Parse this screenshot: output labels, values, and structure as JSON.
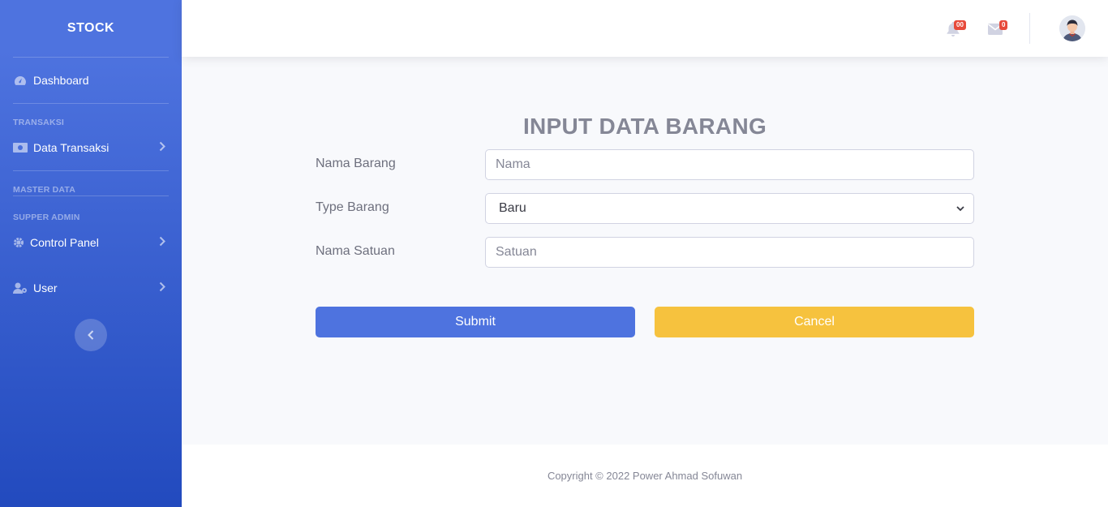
{
  "sidebar": {
    "brand": "STOCK",
    "dashboard": "Dashboard",
    "heading_transaksi": "TRANSAKSI",
    "data_transaksi": "Data Transaksi",
    "heading_master": "MASTER DATA",
    "heading_supper": "SUPPER ADMIN",
    "control_panel": "Control Panel",
    "user": "User"
  },
  "topbar": {
    "alerts_count": "00",
    "messages_count": "0"
  },
  "form": {
    "title": "INPUT DATA BARANG",
    "nama_barang_label": "Nama Barang",
    "nama_barang_placeholder": "Nama",
    "type_barang_label": "Type Barang",
    "type_barang_value": "Baru",
    "nama_satuan_label": "Nama Satuan",
    "nama_satuan_placeholder": "Satuan",
    "submit": "Submit",
    "cancel": "Cancel"
  },
  "footer": {
    "copyright": "Copyright © 2022 Power Ahmad Sofuwan"
  },
  "colors": {
    "primary": "#4e73df",
    "warning": "#f6c23e",
    "danger": "#e74a3b"
  }
}
